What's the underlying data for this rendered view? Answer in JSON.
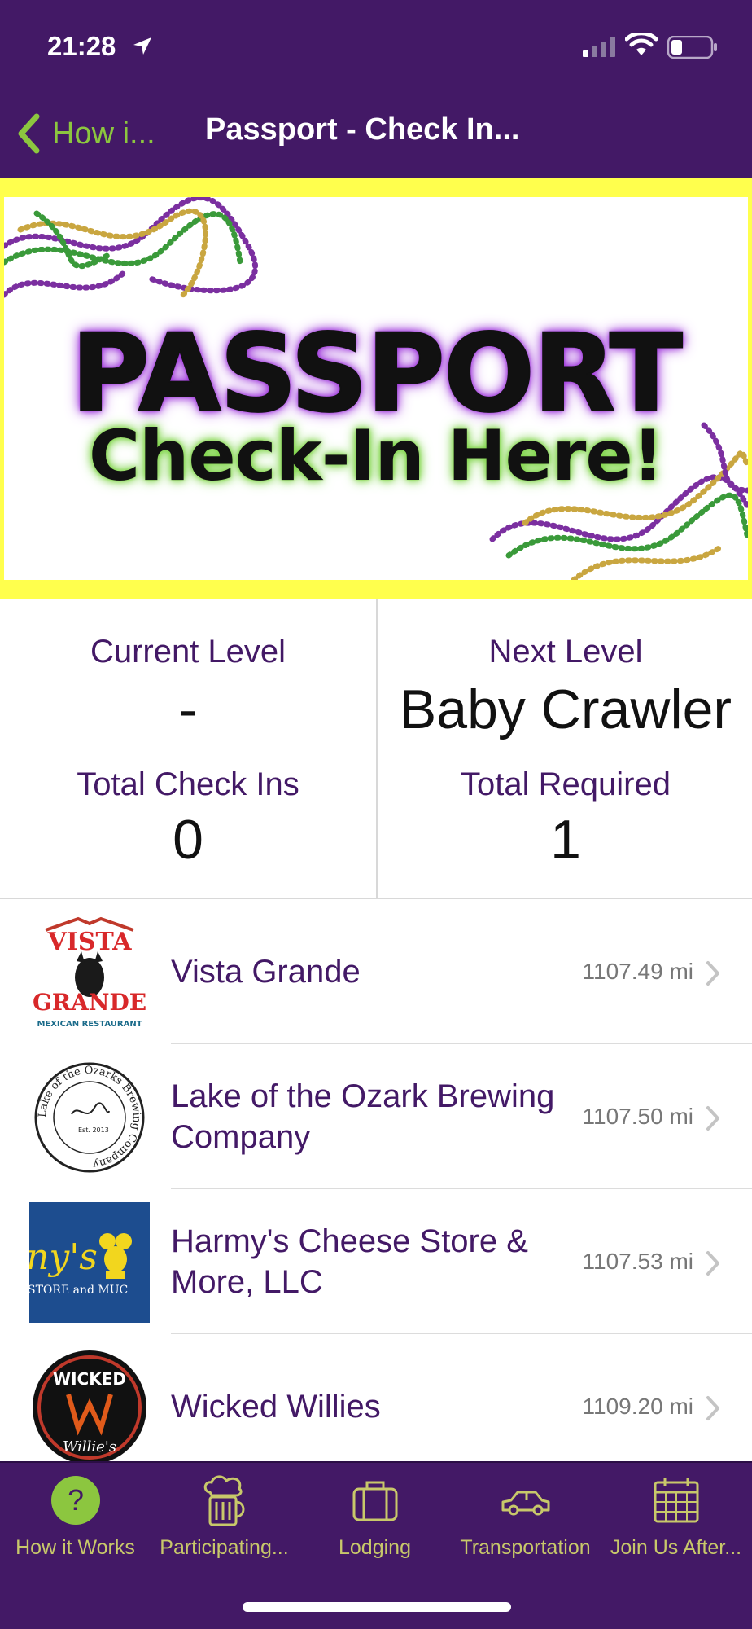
{
  "status_bar": {
    "time": "21:28"
  },
  "nav": {
    "back_label": "How i...",
    "title": "Passport - Check In..."
  },
  "banner": {
    "title_line1": "PASSPORT",
    "title_line2": "Check-In Here!"
  },
  "levels": {
    "current_level_label": "Current Level",
    "current_level_value": "-",
    "next_level_label": "Next Level",
    "next_level_value": "Baby Crawler",
    "total_checkins_label": "Total Check Ins",
    "total_checkins_value": "0",
    "total_required_label": "Total Required",
    "total_required_value": "1"
  },
  "locations": [
    {
      "name": "Vista Grande",
      "distance": "1107.49 mi"
    },
    {
      "name": "Lake of the Ozark Brewing Company",
      "distance": "1107.50 mi"
    },
    {
      "name": "Harmy's Cheese Store & More, LLC",
      "distance": "1107.53 mi"
    },
    {
      "name": "Wicked Willies",
      "distance": "1109.20 mi"
    }
  ],
  "logos": {
    "vista_top": "VISTA",
    "vista_bottom": "GRANDE",
    "vista_sub": "MEXICAN RESTAURANT",
    "lake_ring": "Lake of the Ozarks Brewing Company",
    "lake_est": "Est. 2013",
    "harmy_line1": "ny's",
    "harmy_line2": "STORE and MUC",
    "wicked_top": "WICKED",
    "wicked_bottom": "Willie's"
  },
  "tabs": [
    {
      "label": "How it Works",
      "icon": "question-circle-icon"
    },
    {
      "label": "Participating...",
      "icon": "chef-mug-icon"
    },
    {
      "label": "Lodging",
      "icon": "suitcase-icon"
    },
    {
      "label": "Transportation",
      "icon": "car-icon"
    },
    {
      "label": "Join Us After...",
      "icon": "calendar-icon"
    }
  ],
  "colors": {
    "brand_purple": "#431966",
    "accent_green": "#8cc63f",
    "banner_yellow": "#ffff4d",
    "tab_label": "#c8c86a"
  }
}
